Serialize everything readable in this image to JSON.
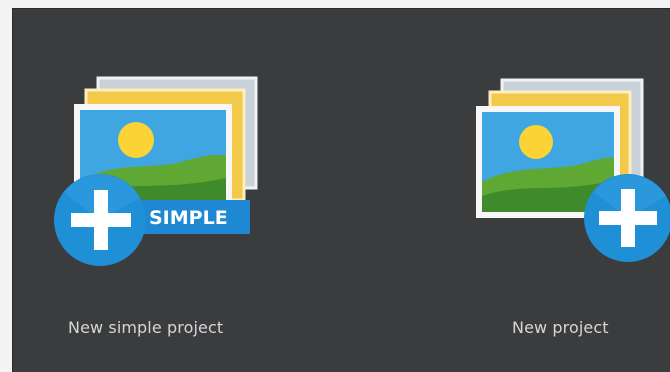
{
  "tiles": [
    {
      "label": "New simple project",
      "badge_text": "SIMPLE",
      "icon": "new-simple-project-icon"
    },
    {
      "label": "New project",
      "icon": "new-project-icon"
    }
  ],
  "colors": {
    "panel_background": "#3b3c3e",
    "page_background": "#f4f4f4",
    "label_text": "#d6d6d6",
    "plus_badge_blue": "#1f8fd6",
    "simple_tag_blue": "#1e88d2",
    "sky_blue": "#3fa6e2",
    "sun_yellow": "#fcd335",
    "hill_green": "#5fa833",
    "hill_green_dark": "#3f8a2a",
    "back_card_yellow": "#f3c94a",
    "back_card_grey": "#c9d2d8"
  }
}
